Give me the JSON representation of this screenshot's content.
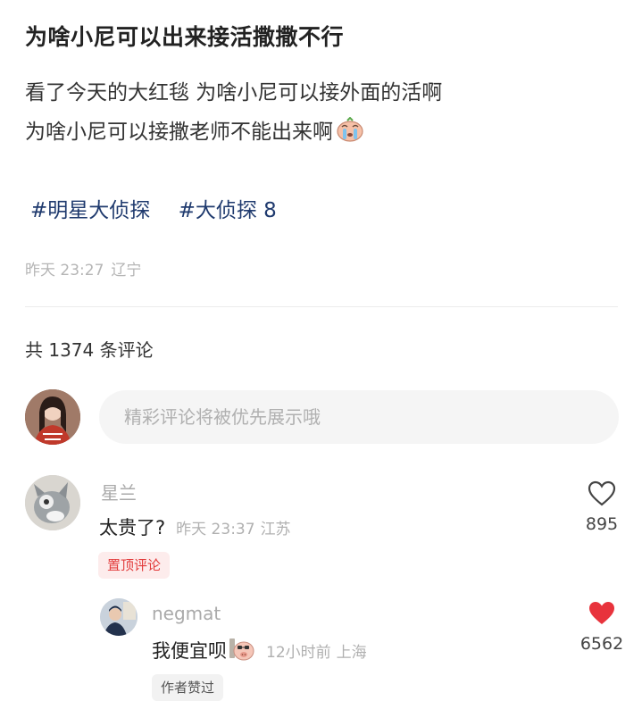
{
  "post": {
    "title": "为啥小尼可以出来接活撒撒不行",
    "line1": "看了今天的大红毯 为啥小尼可以接外面的活啊",
    "line2": "为啥小尼可以接撒老师不能出来啊",
    "tags": [
      "#明星大侦探",
      "#大侦探 8"
    ],
    "time": "昨天 23:27",
    "location": "辽宁"
  },
  "comments_header": {
    "count_text": "共 1374 条评论"
  },
  "input": {
    "placeholder": "精彩评论将被优先展示哦"
  },
  "comments": [
    {
      "user": "星兰",
      "text": "太贵了?",
      "time": "昨天 23:37",
      "location": "江苏",
      "likes": "895",
      "liked": false,
      "badge": "置顶评论"
    }
  ],
  "reply": {
    "user": "negmat",
    "text": "我便宜呗",
    "time": "12小时前",
    "location": "上海",
    "likes": "6562",
    "liked": true,
    "badge": "作者赞过"
  },
  "colors": {
    "tag": "#1f3a6e",
    "heart_active": "#e8333c",
    "pin_badge": "#e23b3b"
  },
  "icons": [
    "crying-emoji-icon",
    "heart-outline-icon",
    "heart-filled-icon",
    "pig-emoji-icon"
  ]
}
